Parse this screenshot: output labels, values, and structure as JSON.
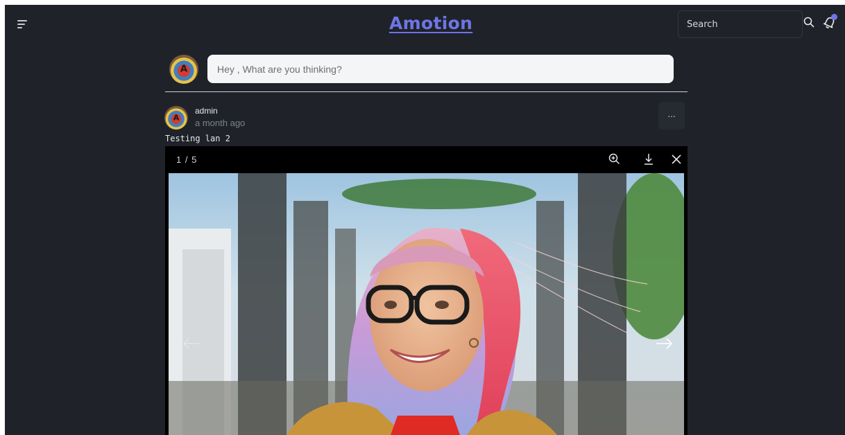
{
  "header": {
    "brand": "Amotion",
    "search_placeholder": "Search",
    "accent_color": "#6f74e6"
  },
  "composer": {
    "avatar_letter": "A",
    "placeholder": "Hey , What are you thinking?"
  },
  "post": {
    "author": "admin",
    "avatar_letter": "A",
    "timestamp": "a month ago",
    "more_label": "...",
    "text": "Testing lan 2"
  },
  "lightbox": {
    "counter": "1 / 5",
    "icons": [
      "zoom-in-icon",
      "download-icon",
      "close-icon",
      "arrow-left-icon",
      "arrow-right-icon"
    ]
  },
  "icons": [
    "menu-icon",
    "search-icon",
    "bell-icon"
  ]
}
